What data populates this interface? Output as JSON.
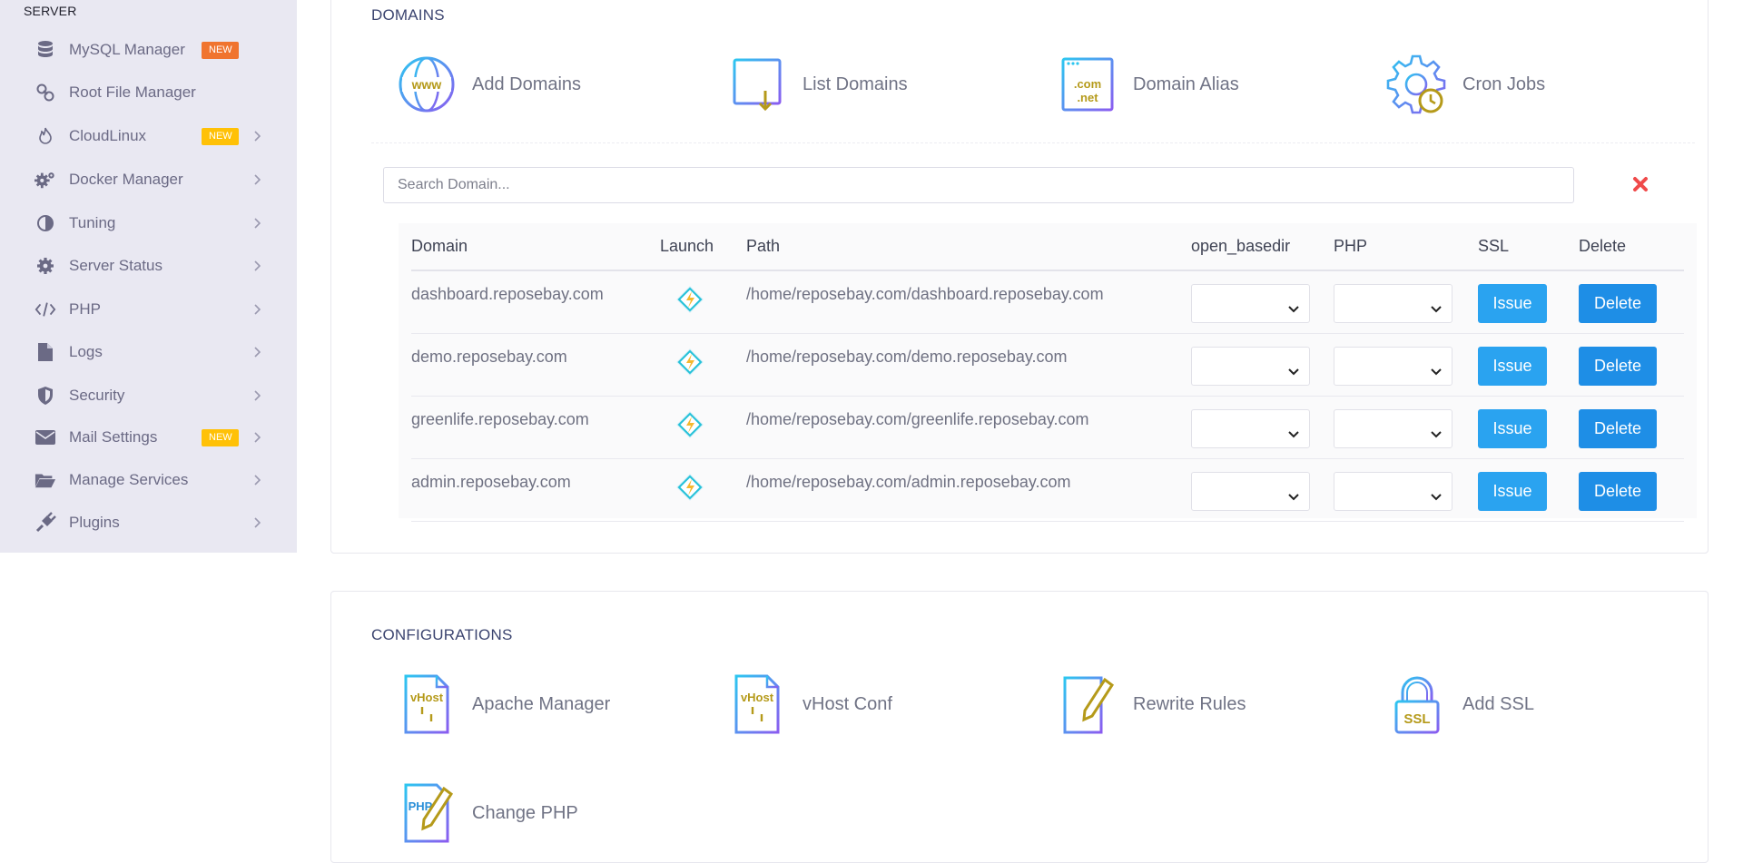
{
  "sidebar": {
    "section_title": "SERVER",
    "items": [
      {
        "label": "MySQL Manager",
        "icon": "database-icon",
        "badge": "NEW",
        "badge_color": "#f0742f",
        "chevron": false
      },
      {
        "label": "Root File Manager",
        "icon": "link-icon",
        "badge": null,
        "chevron": false
      },
      {
        "label": "CloudLinux",
        "icon": "fire-icon",
        "badge": "NEW",
        "badge_color": "#ffc107",
        "chevron": true
      },
      {
        "label": "Docker Manager",
        "icon": "cogs-icon",
        "badge": null,
        "chevron": true
      },
      {
        "label": "Tuning",
        "icon": "contrast-icon",
        "badge": null,
        "chevron": true
      },
      {
        "label": "Server Status",
        "icon": "gear-icon",
        "badge": null,
        "chevron": true
      },
      {
        "label": "PHP",
        "icon": "code-icon",
        "badge": null,
        "chevron": true
      },
      {
        "label": "Logs",
        "icon": "file-icon",
        "badge": null,
        "chevron": true
      },
      {
        "label": "Security",
        "icon": "shield-icon",
        "badge": null,
        "chevron": true
      },
      {
        "label": "Mail Settings",
        "icon": "envelope-icon",
        "badge": "NEW",
        "badge_color": "#ffc107",
        "chevron": true
      },
      {
        "label": "Manage Services",
        "icon": "folder-open-icon",
        "badge": null,
        "chevron": true
      },
      {
        "label": "Plugins",
        "icon": "plug-icon",
        "badge": null,
        "chevron": true
      }
    ]
  },
  "domains_card": {
    "title": "DOMAINS",
    "tiles": [
      {
        "label": "Add Domains",
        "icon": "www-globe-icon"
      },
      {
        "label": "List Domains",
        "icon": "list-document-icon"
      },
      {
        "label": "Domain Alias",
        "icon": "com-net-browser-icon"
      },
      {
        "label": "Cron Jobs",
        "icon": "gear-clock-icon"
      }
    ],
    "search": {
      "placeholder": "Search Domain...",
      "value": ""
    },
    "clear_icon": "close-x-icon",
    "table": {
      "headers": [
        "Domain",
        "Launch",
        "Path",
        "open_basedir",
        "PHP",
        "SSL",
        "Delete"
      ],
      "rows": [
        {
          "domain": "dashboard.reposebay.com",
          "path": "/home/reposebay.com/dashboard.reposebay.com",
          "open_basedir": "",
          "php": "",
          "ssl_label": "Issue",
          "delete_label": "Delete"
        },
        {
          "domain": "demo.reposebay.com",
          "path": "/home/reposebay.com/demo.reposebay.com",
          "open_basedir": "",
          "php": "",
          "ssl_label": "Issue",
          "delete_label": "Delete"
        },
        {
          "domain": "greenlife.reposebay.com",
          "path": "/home/reposebay.com/greenlife.reposebay.com",
          "open_basedir": "",
          "php": "",
          "ssl_label": "Issue",
          "delete_label": "Delete"
        },
        {
          "domain": "admin.reposebay.com",
          "path": "/home/reposebay.com/admin.reposebay.com",
          "open_basedir": "",
          "php": "",
          "ssl_label": "Issue",
          "delete_label": "Delete"
        }
      ]
    }
  },
  "config_card": {
    "title": "CONFIGURATIONS",
    "tiles": [
      {
        "label": "Apache Manager",
        "icon": "vhost-document-icon"
      },
      {
        "label": "vHost Conf",
        "icon": "vhost-document-icon"
      },
      {
        "label": "Rewrite Rules",
        "icon": "document-pencil-icon"
      },
      {
        "label": "Add SSL",
        "icon": "ssl-padlock-icon"
      },
      {
        "label": "Change PHP",
        "icon": "php-document-icon"
      }
    ]
  },
  "colors": {
    "sidebar_bg": "#e9e8f2",
    "primary_button": "#1e8ee6",
    "issue_button": "#2aa3f0",
    "clear_icon": "#f04a4a",
    "badge_orange": "#f0742f",
    "badge_yellow": "#ffc107"
  }
}
